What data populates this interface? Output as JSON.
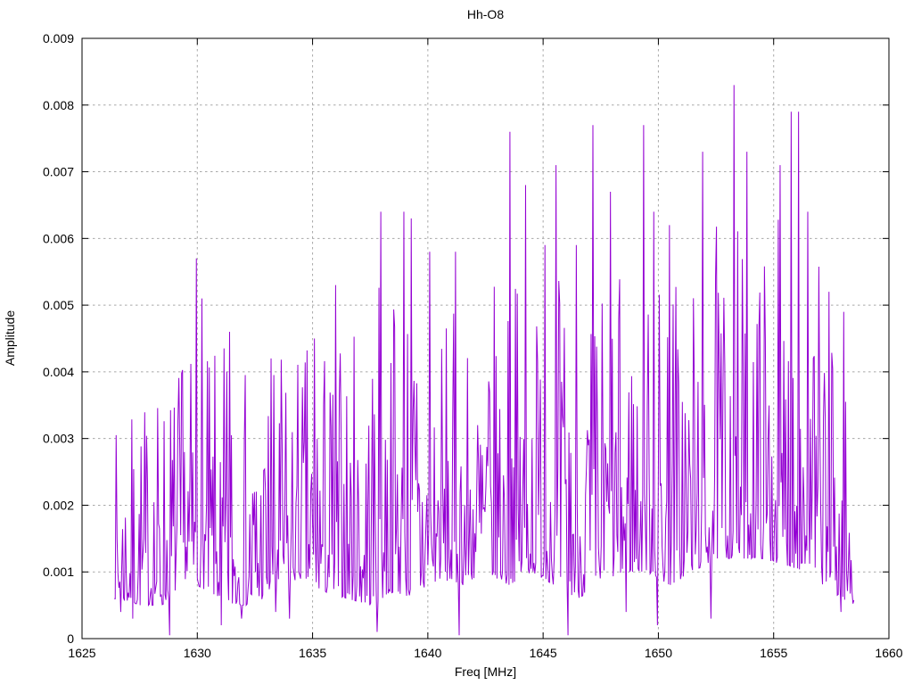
{
  "window": {
    "background": "#ffffff"
  },
  "chart_data": {
    "type": "line",
    "title": "Hh-O8",
    "xlabel": "Freq [MHz]",
    "ylabel": "Amplitude",
    "xlim": [
      1625,
      1660
    ],
    "ylim": [
      0,
      0.009
    ],
    "x_tick_values": [
      1625,
      1630,
      1635,
      1640,
      1645,
      1650,
      1655,
      1660
    ],
    "x_tick_labels": [
      "1625",
      "1630",
      "1635",
      "1640",
      "1645",
      "1650",
      "1655",
      "1660"
    ],
    "y_tick_values": [
      0,
      0.001,
      0.002,
      0.003,
      0.004,
      0.005,
      0.006,
      0.007,
      0.008,
      0.009
    ],
    "y_tick_labels": [
      "0",
      "0.001",
      "0.002",
      "0.003",
      "0.004",
      "0.005",
      "0.006",
      "0.007",
      "0.008",
      "0.009"
    ],
    "grid": true,
    "legend": "none",
    "line_color": "#9400D3",
    "grid_color": "#a8a8a8",
    "border_color": "#000000",
    "series": {
      "name": "Hh-O8",
      "x_start": 1626.4,
      "x_end": 1658.5,
      "x_step": 0.04,
      "seed": 7,
      "noise_exponent": 3,
      "envelope": [
        [
          1626.4,
          0.0006,
          0.0032
        ],
        [
          1627.5,
          0.0005,
          0.0036
        ],
        [
          1628.5,
          0.0005,
          0.0041
        ],
        [
          1629.5,
          0.0009,
          0.0044
        ],
        [
          1630.5,
          0.0007,
          0.0042
        ],
        [
          1631.5,
          0.0005,
          0.0046
        ],
        [
          1632.5,
          0.0005,
          0.0038
        ],
        [
          1633.5,
          0.0008,
          0.0043
        ],
        [
          1634.5,
          0.0009,
          0.0045
        ],
        [
          1635.5,
          0.0007,
          0.0047
        ],
        [
          1636.5,
          0.0006,
          0.0046
        ],
        [
          1637.5,
          0.0005,
          0.0052
        ],
        [
          1638.5,
          0.0007,
          0.0058
        ],
        [
          1639.5,
          0.0006,
          0.0056
        ],
        [
          1640.5,
          0.0009,
          0.005
        ],
        [
          1641.5,
          0.0008,
          0.0048
        ],
        [
          1642.5,
          0.001,
          0.0052
        ],
        [
          1643.5,
          0.0008,
          0.0056
        ],
        [
          1644.5,
          0.001,
          0.0055
        ],
        [
          1645.5,
          0.0008,
          0.0056
        ],
        [
          1646.5,
          0.0006,
          0.0054
        ],
        [
          1647.5,
          0.0008,
          0.0056
        ],
        [
          1648.5,
          0.001,
          0.0055
        ],
        [
          1649.5,
          0.001,
          0.0058
        ],
        [
          1650.5,
          0.0008,
          0.006
        ],
        [
          1651.5,
          0.001,
          0.0058
        ],
        [
          1652.5,
          0.0012,
          0.0062
        ],
        [
          1653.5,
          0.0012,
          0.0064
        ],
        [
          1654.5,
          0.0012,
          0.0062
        ],
        [
          1655.5,
          0.0011,
          0.0066
        ],
        [
          1656.5,
          0.001,
          0.0062
        ],
        [
          1657.5,
          0.0007,
          0.005
        ],
        [
          1658.0,
          0.0006,
          0.0044
        ],
        [
          1658.5,
          0.0005,
          0.002
        ]
      ],
      "peaks": [
        [
          1629.95,
          0.0057
        ],
        [
          1630.2,
          0.0051
        ],
        [
          1631.4,
          0.0046
        ],
        [
          1633.2,
          0.0042
        ],
        [
          1635.1,
          0.0045
        ],
        [
          1636.0,
          0.0053
        ],
        [
          1637.95,
          0.0064
        ],
        [
          1638.95,
          0.0064
        ],
        [
          1639.3,
          0.0063
        ],
        [
          1640.1,
          0.0058
        ],
        [
          1641.2,
          0.0058
        ],
        [
          1643.55,
          0.0076
        ],
        [
          1644.25,
          0.0068
        ],
        [
          1645.1,
          0.0059
        ],
        [
          1645.55,
          0.0071
        ],
        [
          1646.45,
          0.0059
        ],
        [
          1647.15,
          0.0077
        ],
        [
          1647.9,
          0.0067
        ],
        [
          1649.35,
          0.0077
        ],
        [
          1649.8,
          0.0064
        ],
        [
          1650.5,
          0.0062
        ],
        [
          1651.9,
          0.0073
        ],
        [
          1653.3,
          0.0083
        ],
        [
          1653.85,
          0.0073
        ],
        [
          1655.3,
          0.0071
        ],
        [
          1655.75,
          0.0079
        ],
        [
          1656.1,
          0.0079
        ],
        [
          1656.5,
          0.0064
        ],
        [
          1657.4,
          0.0052
        ],
        [
          1658.05,
          0.0049
        ]
      ],
      "dips": [
        [
          1626.7,
          0.0004
        ],
        [
          1627.2,
          0.0003
        ],
        [
          1628.8,
          5e-05
        ],
        [
          1631.05,
          0.0002
        ],
        [
          1631.9,
          0.0003
        ],
        [
          1633.4,
          0.0004
        ],
        [
          1634.0,
          0.0003
        ],
        [
          1637.8,
          0.0001
        ],
        [
          1641.35,
          5e-05
        ],
        [
          1646.1,
          5e-05
        ],
        [
          1648.6,
          0.0004
        ],
        [
          1649.95,
          0.0002
        ],
        [
          1652.3,
          0.0003
        ],
        [
          1657.9,
          0.0004
        ]
      ]
    }
  }
}
